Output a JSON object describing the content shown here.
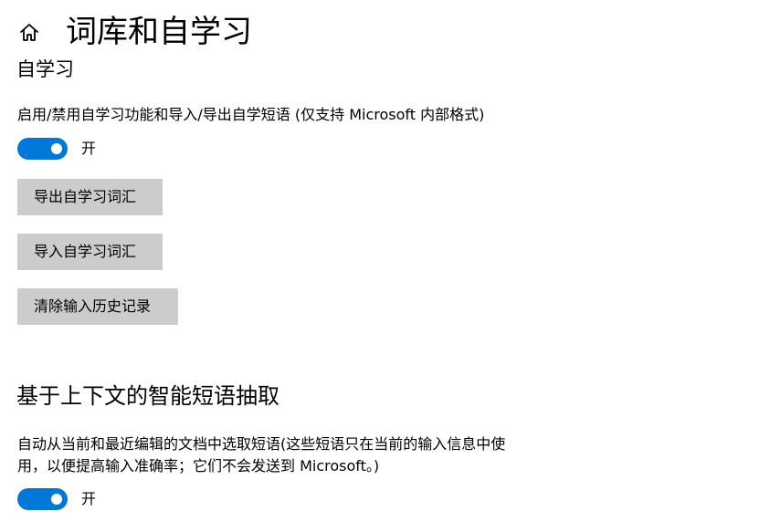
{
  "header": {
    "title": "词库和自学习",
    "home_icon": "home-icon"
  },
  "self_learning": {
    "section_title": "自学习",
    "description": "启用/禁用自学习功能和导入/导出自学短语 (仅支持 Microsoft 内部格式)",
    "toggle": {
      "state": "on",
      "label": "开"
    },
    "buttons": {
      "export_label": "导出自学习词汇",
      "import_label": "导入自学习词汇",
      "clear_label": "清除输入历史记录"
    }
  },
  "contextual_extraction": {
    "section_title": "基于上下文的智能短语抽取",
    "description": "自动从当前和最近编辑的文档中选取短语(这些短语只在当前的输入信息中使用，以便提高输入准确率；它们不会发送到 Microsoft。)",
    "toggle": {
      "state": "on",
      "label": "开"
    }
  },
  "colors": {
    "accent": "#0078d7",
    "button_bg": "#cccccc",
    "background": "#ffffff",
    "text": "#000000"
  }
}
